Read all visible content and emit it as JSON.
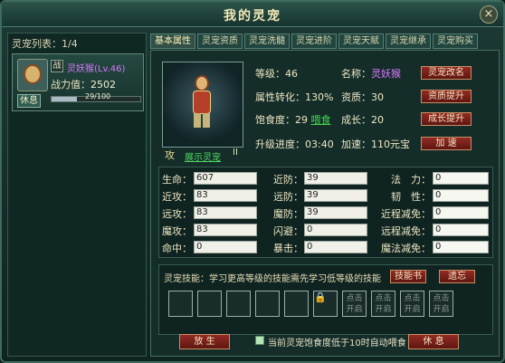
{
  "window": {
    "title": "我的灵宠",
    "close_icon": "×"
  },
  "sidebar": {
    "list_title": "灵宠列表：1/4",
    "pet": {
      "battle_tag": "战",
      "name": "灵妖猴(Lv.46)",
      "power_label": "战力值：",
      "power_value": "2502",
      "rest_button": "休息",
      "progress": "29/100",
      "progress_fraction": 0.29
    }
  },
  "tabs": [
    "基本属性",
    "灵宠资质",
    "灵宠洗髓",
    "灵宠进阶",
    "灵宠天赋",
    "灵宠继承",
    "灵宠购买"
  ],
  "detail": {
    "portrait_attack": "攻",
    "portrait_grade": "II",
    "show_pet_link": "展示灵宠",
    "level_label": "等级：",
    "level_value": "46",
    "name_label": "名称：",
    "name_value": "灵妖猴",
    "rename_button": "灵宠改名",
    "attr_conversion_label": "属性转化：",
    "attr_conversion_value": "130%",
    "aptitude_label": "资质：",
    "aptitude_value": "30",
    "aptitude_button": "资质提升",
    "satiety_label": "饱食度：",
    "satiety_value": "29",
    "feed_link": "喂食",
    "growth_label": "成长：",
    "growth_value": "20",
    "growth_button": "成长提升",
    "upgrade_label": "升级进度：",
    "upgrade_value": "03:40",
    "accelerate_label": "加速：",
    "accelerate_value": "110元宝",
    "accelerate_button": "加  速"
  },
  "attributes": {
    "left": [
      {
        "label": "生命：",
        "value": "607"
      },
      {
        "label": "近攻：",
        "value": "83"
      },
      {
        "label": "远攻：",
        "value": "83"
      },
      {
        "label": "魔攻：",
        "value": "83"
      },
      {
        "label": "命中：",
        "value": "0"
      }
    ],
    "middle": [
      {
        "label": "近防：",
        "value": "39"
      },
      {
        "label": "远防：",
        "value": "39"
      },
      {
        "label": "魔防：",
        "value": "39"
      },
      {
        "label": "闪避：",
        "value": "0"
      },
      {
        "label": "暴击：",
        "value": "0"
      }
    ],
    "right": [
      {
        "label": "法　力：",
        "value": "0"
      },
      {
        "label": "韧　性：",
        "value": "0"
      },
      {
        "label": "近程减免：",
        "value": "0"
      },
      {
        "label": "远程减免：",
        "value": "0"
      },
      {
        "label": "魔法减免：",
        "value": "0"
      }
    ]
  },
  "skills": {
    "title": "灵宠技能：学习更高等级的技能需先学习低等级的技能",
    "book_button": "技能书",
    "forget_button": "遗忘",
    "locked_slot_text": "点击开启"
  },
  "bottom": {
    "release_button": "放  生",
    "auto_feed": "当前灵宠饱食度低于10时自动喂食",
    "rest_button": "休  息"
  }
}
